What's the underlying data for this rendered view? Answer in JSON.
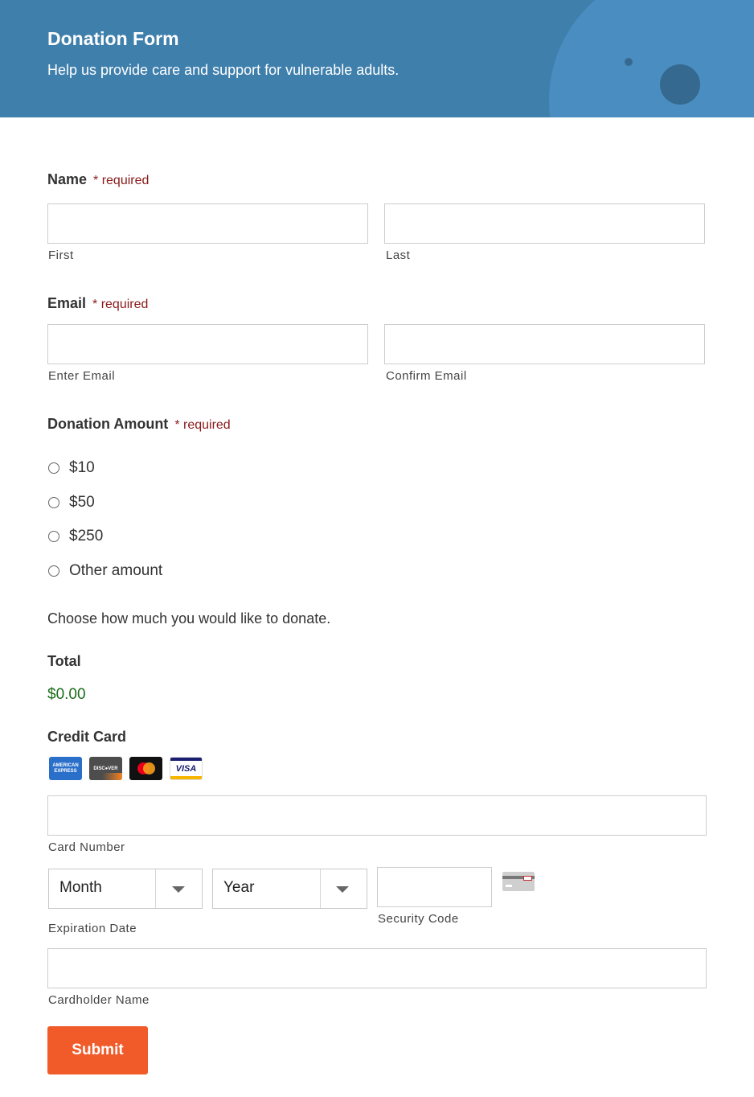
{
  "header": {
    "title": "Donation Form",
    "subtitle": "Help us provide care and support for vulnerable adults."
  },
  "required_text": "* required",
  "name": {
    "label": "Name",
    "first_label": "First",
    "last_label": "Last",
    "first_value": "",
    "last_value": ""
  },
  "email": {
    "label": "Email",
    "enter_label": "Enter Email",
    "confirm_label": "Confirm Email",
    "enter_value": "",
    "confirm_value": ""
  },
  "donation": {
    "label": "Donation Amount",
    "options": [
      "$10",
      "$50",
      "$250",
      "Other amount"
    ],
    "selected": null,
    "help": "Choose how much you would like to donate."
  },
  "total": {
    "label": "Total",
    "value": "$0.00"
  },
  "credit_card": {
    "label": "Credit Card",
    "card_icons": [
      "amex-icon",
      "discover-icon",
      "mastercard-icon",
      "visa-icon"
    ],
    "amex_text": "AMERICAN EXPRESS",
    "discover_text": "DISC●VER",
    "visa_text": "VISA",
    "number_label": "Card Number",
    "number_value": "",
    "month_value": "Month",
    "year_value": "Year",
    "expiration_label": "Expiration Date",
    "security_label": "Security Code",
    "security_value": "",
    "cardholder_label": "Cardholder Name",
    "cardholder_value": ""
  },
  "submit_label": "Submit",
  "colors": {
    "header_bg": "#3f7fac",
    "required": "#8a1a1a",
    "total": "#1a6d1a",
    "submit_bg": "#f15a29"
  }
}
